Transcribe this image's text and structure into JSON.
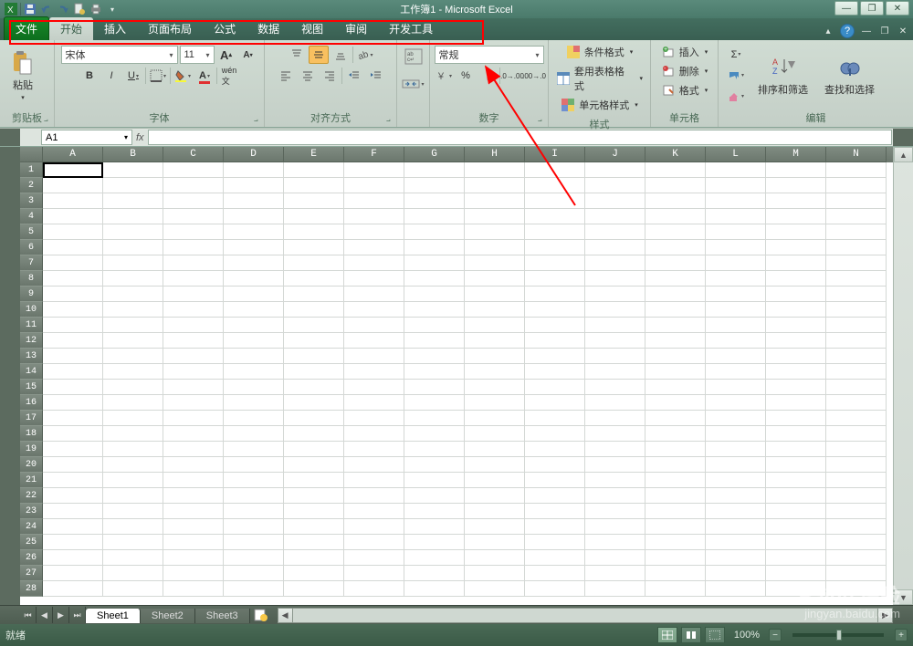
{
  "titlebar": {
    "title": "工作簿1 - Microsoft Excel"
  },
  "tabs": {
    "file": "文件",
    "items": [
      "开始",
      "插入",
      "页面布局",
      "公式",
      "数据",
      "视图",
      "审阅",
      "开发工具"
    ],
    "active_index": 0
  },
  "ribbon": {
    "clipboard": {
      "paste": "粘贴",
      "label": "剪贴板"
    },
    "font": {
      "name": "宋体",
      "size": "11",
      "increase": "A",
      "decrease": "A",
      "bold": "B",
      "italic": "I",
      "underline": "U",
      "label": "字体"
    },
    "alignment": {
      "label": "对齐方式"
    },
    "number": {
      "format": "常规",
      "label": "数字"
    },
    "styles": {
      "conditional": "条件格式",
      "table": "套用表格格式",
      "cell": "单元格样式",
      "label": "样式"
    },
    "cells": {
      "insert": "插入",
      "delete": "删除",
      "format": "格式",
      "label": "单元格"
    },
    "editing": {
      "sort": "排序和筛选",
      "find": "查找和选择",
      "label": "编辑"
    }
  },
  "namebox": {
    "value": "A1",
    "fx": "fx"
  },
  "grid": {
    "columns": [
      "A",
      "B",
      "C",
      "D",
      "E",
      "F",
      "G",
      "H",
      "I",
      "J",
      "K",
      "L",
      "M",
      "N"
    ],
    "rows": 28
  },
  "sheets": {
    "items": [
      "Sheet1",
      "Sheet2",
      "Sheet3"
    ],
    "active_index": 0
  },
  "statusbar": {
    "ready": "就绪",
    "zoom": "100%",
    "minus": "−",
    "plus": "+"
  },
  "watermark": {
    "brand": "Baidu 经验",
    "url": "jingyan.baidu.com"
  }
}
